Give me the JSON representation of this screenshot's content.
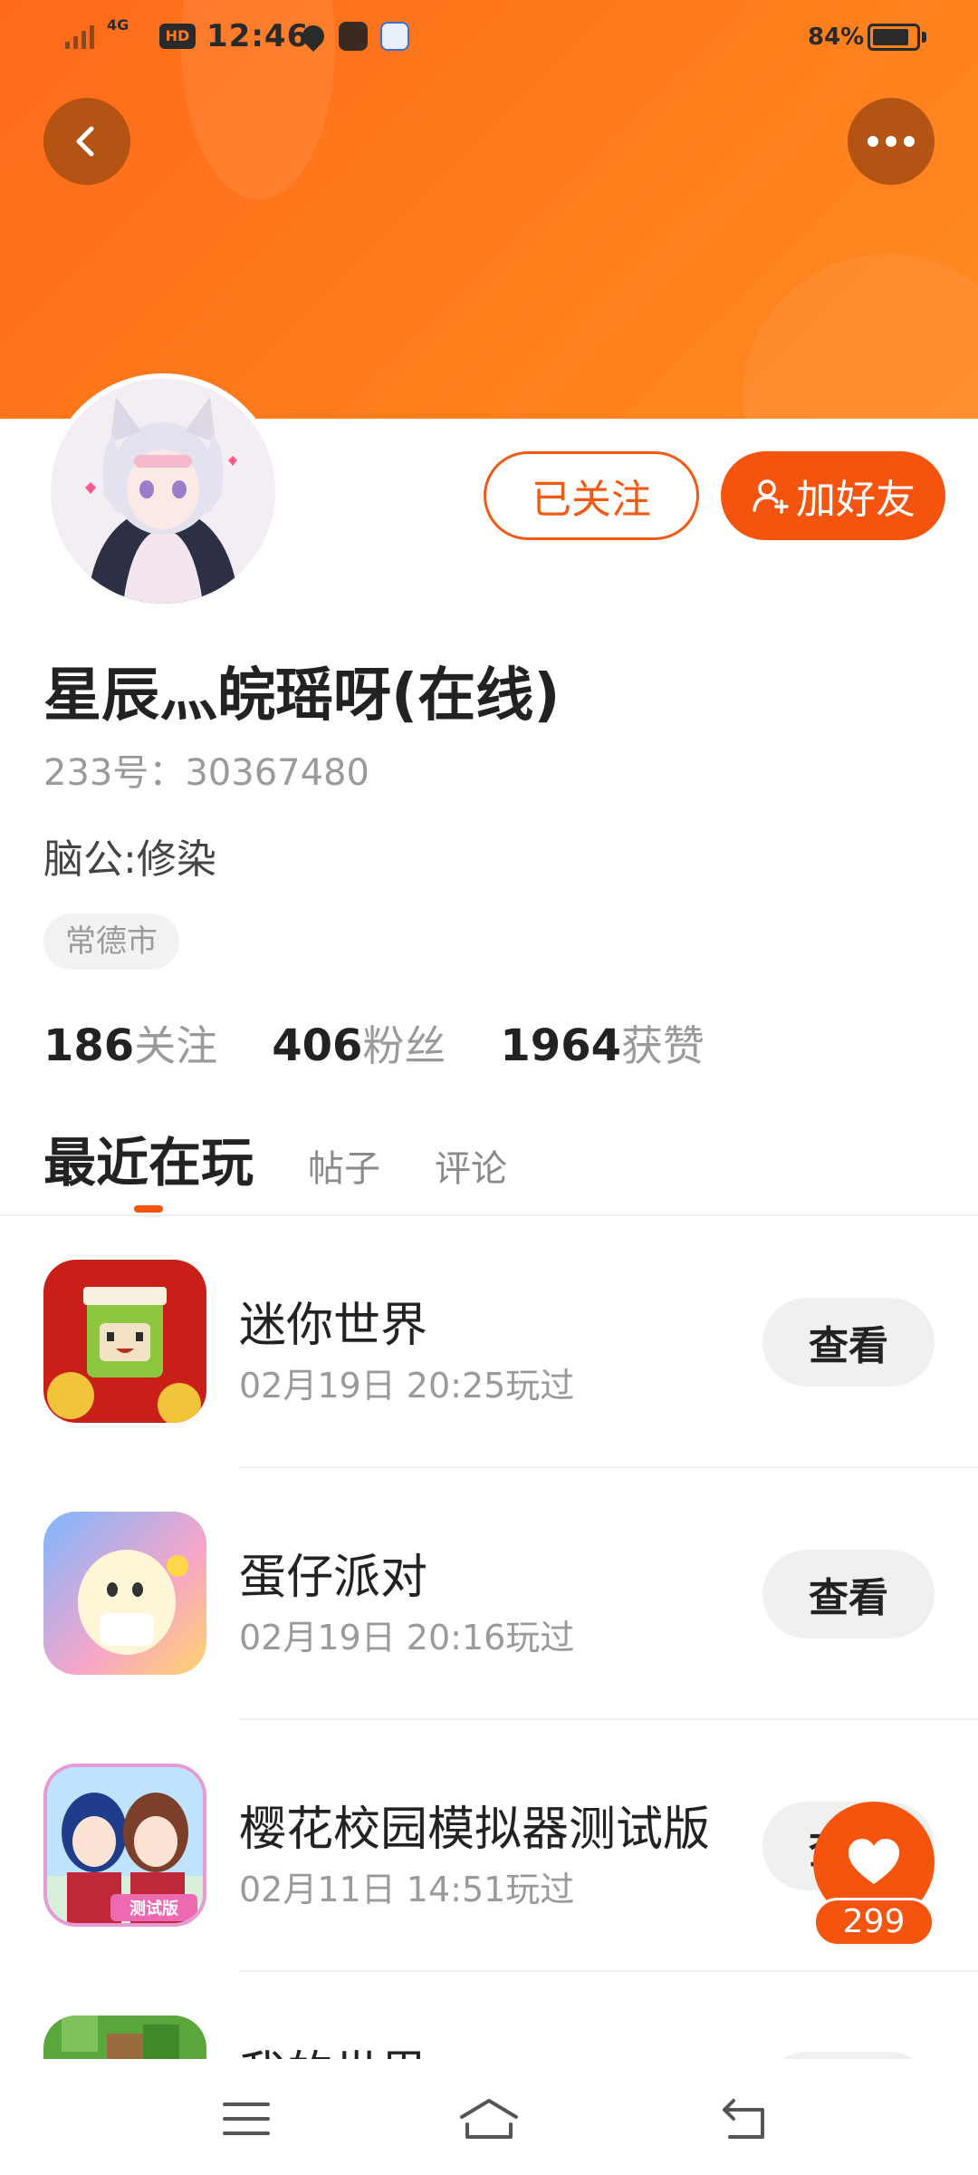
{
  "status_bar": {
    "network": "4G",
    "hd": "HD",
    "time": "12:46",
    "battery": "84%",
    "battery_level": 0.84
  },
  "header": {
    "back_icon": "chevron-left-icon",
    "more_icon": "more-dots-icon"
  },
  "profile": {
    "username": "星辰灬皖瑶呀(在线)",
    "uid": "233号：30367480",
    "bio": "脑公:修染",
    "location": "常德市",
    "follow_label": "已关注",
    "add_friend_label": "加好友"
  },
  "stats": [
    {
      "num": "186",
      "label": "关注"
    },
    {
      "num": "406",
      "label": "粉丝"
    },
    {
      "num": "1964",
      "label": "获赞"
    }
  ],
  "tabs": [
    {
      "label": "最近在玩"
    },
    {
      "label": "帖子"
    },
    {
      "label": "评论"
    }
  ],
  "games": [
    {
      "name": "迷你世界",
      "time": "02月19日 20:25玩过",
      "action": "查看"
    },
    {
      "name": "蛋仔派对",
      "time": "02月19日 20:16玩过",
      "action": "查看"
    },
    {
      "name": "樱花校园模拟器测试版",
      "time": "02月11日 14:51玩过",
      "action": "查看"
    },
    {
      "name": "我的世界",
      "time": "",
      "action": ""
    }
  ],
  "like": {
    "count": "299",
    "icon": "heart-icon"
  },
  "nav": {
    "menu_icon": "menu-icon",
    "home_icon": "home-icon",
    "back_icon": "return-icon"
  },
  "colors": {
    "accent": "#f4540e",
    "banner": "#ff7a1c"
  }
}
